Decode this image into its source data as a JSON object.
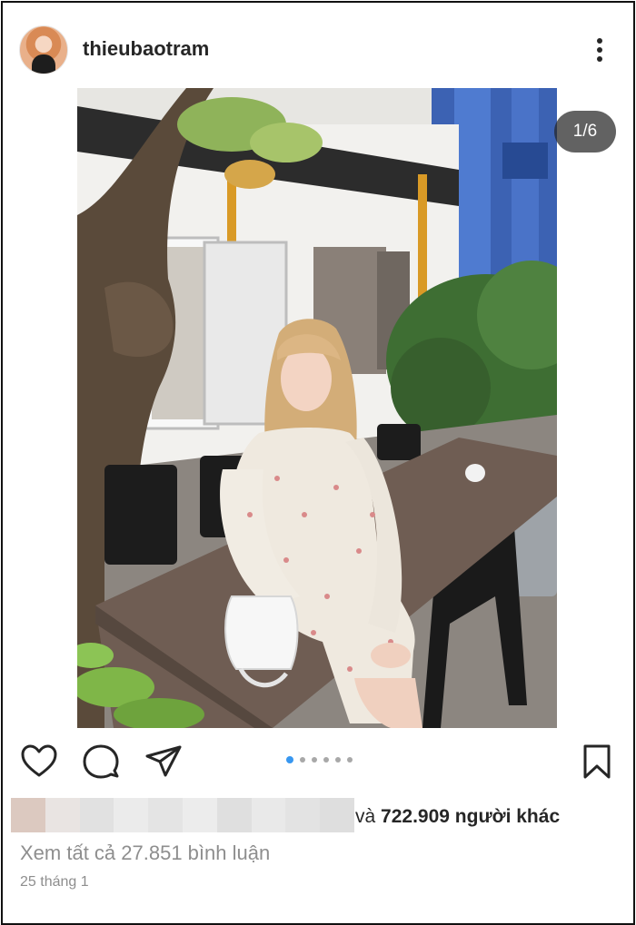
{
  "post": {
    "username": "thieubaotram",
    "counter": "1/6",
    "carousel": {
      "total": 6,
      "active": 0
    },
    "likes_prefix": "và",
    "likes_count": "722.909",
    "likes_suffix": "người khác",
    "view_comments": "Xem tất cả 27.851 bình luận",
    "timestamp": "25 tháng 1"
  },
  "icons": {
    "more": "more-vertical-icon",
    "like": "heart-icon",
    "comment": "comment-icon",
    "share": "send-icon",
    "save": "bookmark-icon"
  },
  "colors": {
    "text": "#262626",
    "secondary": "#8e8e8e",
    "active_dot": "#3897f0",
    "inactive_dot": "#a8a8a8",
    "counter_bg": "#262626"
  }
}
